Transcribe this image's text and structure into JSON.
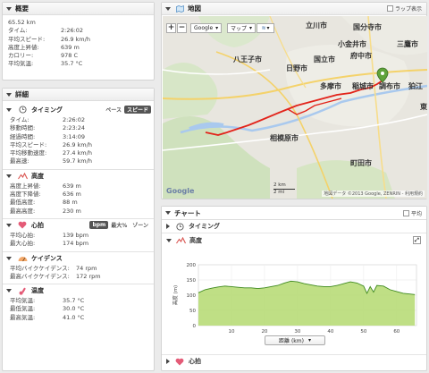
{
  "summary": {
    "title": "概要",
    "rows": [
      {
        "k": "65.52 km",
        "v": ""
      },
      {
        "k": "タイム:",
        "v": "2:26:02"
      },
      {
        "k": "平均スピード:",
        "v": "26.9 km/h"
      },
      {
        "k": "高度上昇値:",
        "v": "639 m"
      },
      {
        "k": "カロリー:",
        "v": "978 C"
      },
      {
        "k": "平均気温:",
        "v": "35.7 °C"
      }
    ]
  },
  "details": {
    "title": "詳細",
    "timing": {
      "title": "タイミング",
      "pace_label": "ペース",
      "speed_label": "スピード",
      "rows": [
        {
          "k": "タイム:",
          "v": "2:26:02"
        },
        {
          "k": "移動時間:",
          "v": "2:23:24"
        },
        {
          "k": "経過時間:",
          "v": "3:14:09"
        },
        {
          "k": "平均スピード:",
          "v": "26.9 km/h"
        },
        {
          "k": "平均移動速度:",
          "v": "27.4 km/h"
        },
        {
          "k": "最高速:",
          "v": "59.7 km/h"
        }
      ]
    },
    "elevation": {
      "title": "高度",
      "rows": [
        {
          "k": "高度上昇値:",
          "v": "639 m"
        },
        {
          "k": "高度下降値:",
          "v": "636 m"
        },
        {
          "k": "最低高度:",
          "v": "88 m"
        },
        {
          "k": "最高高度:",
          "v": "230 m"
        }
      ]
    },
    "heart": {
      "title": "心拍",
      "bpm_label": "bpm",
      "max_label": "最大%",
      "zone_label": "ゾーン",
      "rows": [
        {
          "k": "平均心拍:",
          "v": "139 bpm"
        },
        {
          "k": "最大心拍:",
          "v": "174 bpm"
        }
      ]
    },
    "cadence": {
      "title": "ケイデンス",
      "rows": [
        {
          "k": "平均バイクケイデンス:",
          "v": "74 rpm"
        },
        {
          "k": "最高バイクケイデンス:",
          "v": "172 rpm"
        }
      ]
    },
    "temperature": {
      "title": "温度",
      "rows": [
        {
          "k": "平均気温:",
          "v": "35.7 °C"
        },
        {
          "k": "最低気温:",
          "v": "30.0 °C"
        },
        {
          "k": "最高気温:",
          "v": "41.0 °C"
        }
      ]
    }
  },
  "map": {
    "title": "地図",
    "lap_label": "ラップ表示",
    "zoom_in": "+",
    "zoom_out": "−",
    "google_label": "Google",
    "map_label": "マップ",
    "google_logo": "Google",
    "copyright": "地図データ ©2013 Google, ZENRIN - 利用規約",
    "scale_km": "2 km",
    "scale_mi": "2 mi",
    "cities": [
      {
        "name": "立川市"
      },
      {
        "name": "国分寺市"
      },
      {
        "name": "小金井市"
      },
      {
        "name": "三鷹市"
      },
      {
        "name": "府中市"
      },
      {
        "name": "国立市"
      },
      {
        "name": "日野市"
      },
      {
        "name": "八王子市"
      },
      {
        "name": "多摩市"
      },
      {
        "name": "稲城市"
      },
      {
        "name": "調布市"
      },
      {
        "name": "狛江"
      },
      {
        "name": "相模原市"
      },
      {
        "name": "町田市"
      },
      {
        "name": "東"
      }
    ]
  },
  "chart_panel": {
    "title": "チャート",
    "avg_label": "平均",
    "timing_label": "タイミング",
    "elevation_label": "高度",
    "heart_label": "心拍",
    "distance_select": "距離 (km)"
  },
  "chart_data": {
    "type": "area",
    "ylabel": "高度 (m)",
    "xlabel": "",
    "xlim": [
      0,
      66
    ],
    "ylim": [
      0,
      200
    ],
    "yticks": [
      "200",
      "150",
      "100",
      "50",
      "0"
    ],
    "xticks": [
      "10",
      "20",
      "30",
      "40",
      "50",
      "60"
    ],
    "x": [
      0,
      2,
      4,
      6,
      8,
      10,
      12,
      14,
      16,
      18,
      20,
      22,
      24,
      26,
      28,
      30,
      32,
      34,
      36,
      38,
      40,
      42,
      44,
      46,
      48,
      50,
      51,
      52,
      53,
      54,
      56,
      58,
      60,
      62,
      64,
      65.5
    ],
    "values": [
      108,
      118,
      123,
      127,
      130,
      128,
      126,
      124,
      124,
      122,
      124,
      128,
      132,
      140,
      146,
      144,
      138,
      134,
      130,
      128,
      128,
      132,
      138,
      144,
      140,
      130,
      106,
      128,
      110,
      132,
      130,
      118,
      112,
      106,
      104,
      102
    ],
    "color": "#b8dc78",
    "line_color": "#3f8a1f"
  }
}
